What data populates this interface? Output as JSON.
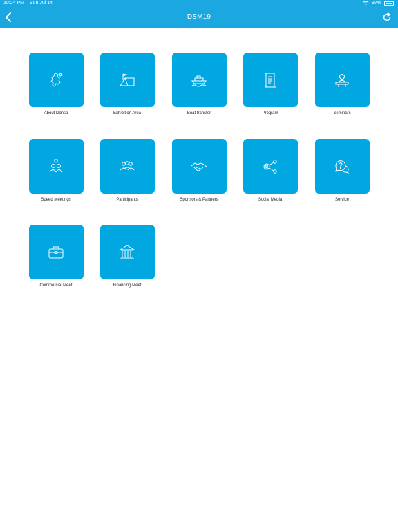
{
  "status": {
    "time": "10:24 PM",
    "date": "Sun Jul 14",
    "battery": "97%"
  },
  "nav": {
    "title": "DSM19"
  },
  "colors": {
    "accent": "#00a7e1",
    "bar": "#1ba8e0"
  },
  "tiles": [
    {
      "label": "About Donso",
      "icon": "map-icon"
    },
    {
      "label": "Exhibition Area",
      "icon": "tent-icon"
    },
    {
      "label": "Boat transfer",
      "icon": "boat-icon"
    },
    {
      "label": "Program",
      "icon": "scroll-icon"
    },
    {
      "label": "Seminars",
      "icon": "speaker-icon"
    },
    {
      "label": "Speed Meetings",
      "icon": "meeting-icon"
    },
    {
      "label": "Participants",
      "icon": "group-icon"
    },
    {
      "label": "Sponsors & Partners",
      "icon": "handshake-icon"
    },
    {
      "label": "Social Media",
      "icon": "share-icon"
    },
    {
      "label": "Service",
      "icon": "chat-question-icon"
    },
    {
      "label": "Commercial Meet",
      "icon": "briefcase-icon"
    },
    {
      "label": "Financing Meet",
      "icon": "bank-icon"
    }
  ]
}
